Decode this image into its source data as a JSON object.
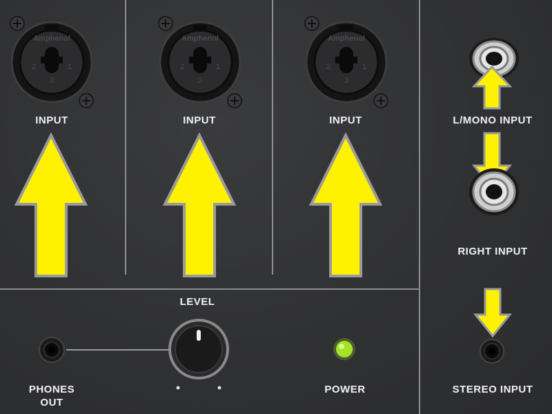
{
  "channels": [
    {
      "label": "INPUT",
      "connector_brand": "Amphenol",
      "pin_numbers": [
        "2",
        "1",
        "3"
      ]
    },
    {
      "label": "INPUT",
      "connector_brand": "Amphenol",
      "pin_numbers": [
        "2",
        "1",
        "3"
      ]
    },
    {
      "label": "INPUT",
      "connector_brand": "Amphenol",
      "pin_numbers": [
        "2",
        "1",
        "3"
      ]
    }
  ],
  "aux_inputs": {
    "left_label": "L/MONO INPUT",
    "right_label": "RIGHT INPUT",
    "stereo_label": "STEREO INPUT"
  },
  "bottom": {
    "level_label": "LEVEL",
    "phones_label": "PHONES\nOUT",
    "power_label": "POWER"
  },
  "colors": {
    "panel": "#2f3032",
    "arrow_fill": "#fff200",
    "arrow_outline": "#9a9a9a",
    "led": "#a6e22a",
    "label_text": "#f2f2f2"
  },
  "icons": [
    "xlr-combo-jack-icon",
    "quarter-inch-jack-icon",
    "eighth-inch-jack-icon",
    "level-knob-icon",
    "power-led-icon",
    "arrow-up-icon",
    "arrow-down-icon",
    "screw-icon"
  ]
}
